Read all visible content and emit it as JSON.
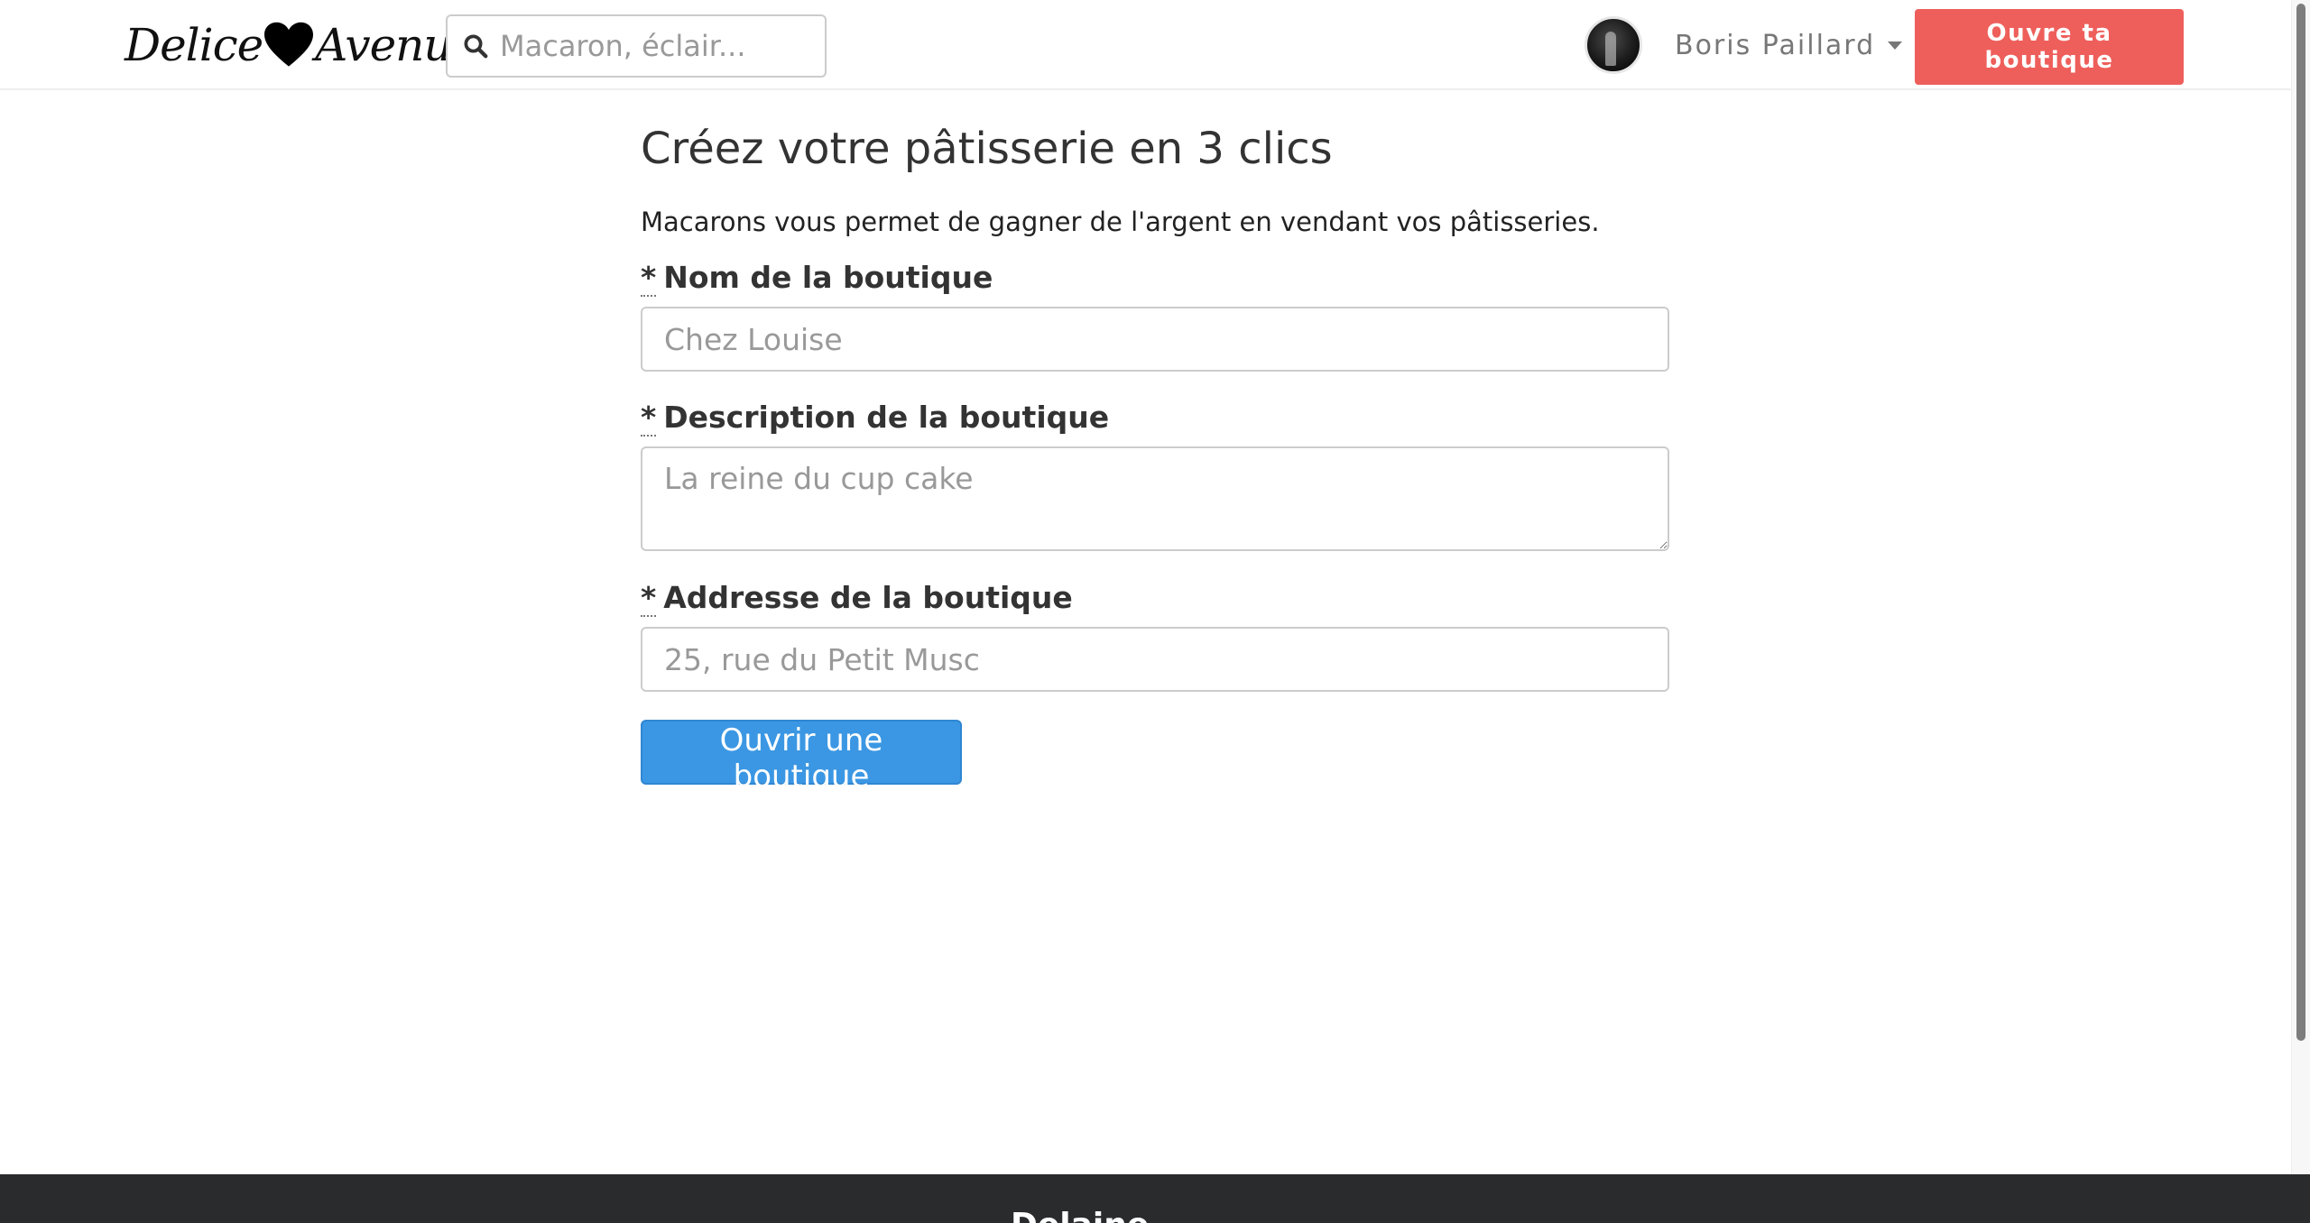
{
  "navbar": {
    "logo_part1": "Delice",
    "logo_part2": "Avenue",
    "search": {
      "placeholder": "Macaron, éclair..."
    },
    "user_name": "Boris Paillard",
    "open_shop_label": "Ouvre ta boutique"
  },
  "main": {
    "title": "Créez votre pâtisserie en 3 clics",
    "intro": "Macarons vous permet de gagner de l'argent en vendant vos pâtisseries.",
    "required_mark": "*",
    "fields": [
      {
        "label": "Nom de la boutique",
        "placeholder": "Chez Louise",
        "value": ""
      },
      {
        "label": "Description de la boutique",
        "placeholder": "La reine du cup cake",
        "value": ""
      },
      {
        "label": "Addresse de la boutique",
        "placeholder": "25, rue du Petit Musc",
        "value": ""
      }
    ],
    "submit_label": "Ouvrir une boutique"
  },
  "footer": {
    "brand": "Delaine"
  },
  "colors": {
    "accent_red": "#ee5f5b",
    "primary_blue": "#3b97e3",
    "footer_bg": "#2a2b2d"
  },
  "icons": [
    "heart-icon",
    "search-icon",
    "caret-down-icon"
  ]
}
